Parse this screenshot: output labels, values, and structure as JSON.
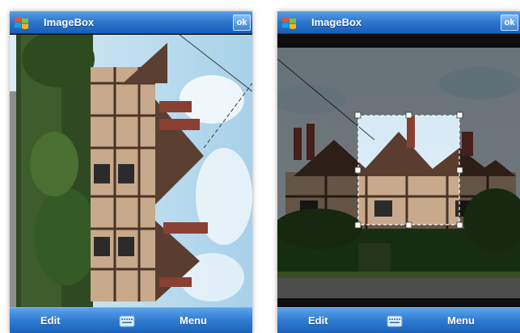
{
  "screens": [
    {
      "id": "rotated-view",
      "title_bar": {
        "app_title": "ImageBox",
        "ok_label": "ok",
        "start_icon": "windows-flag-icon"
      },
      "soft_keys": {
        "left_label": "Edit",
        "right_label": "Menu",
        "center_icon": "keyboard-icon"
      }
    },
    {
      "id": "crop-view",
      "title_bar": {
        "app_title": "ImageBox",
        "ok_label": "ok",
        "start_icon": "windows-flag-icon"
      },
      "soft_keys": {
        "left_label": "Edit",
        "right_label": "Menu",
        "center_icon": "keyboard-icon"
      }
    }
  ],
  "colors": {
    "title_bar": "#2f78cf",
    "soft_bar": "#2f7bd2",
    "crop_overlay": "rgba(0,0,0,0.5)"
  }
}
